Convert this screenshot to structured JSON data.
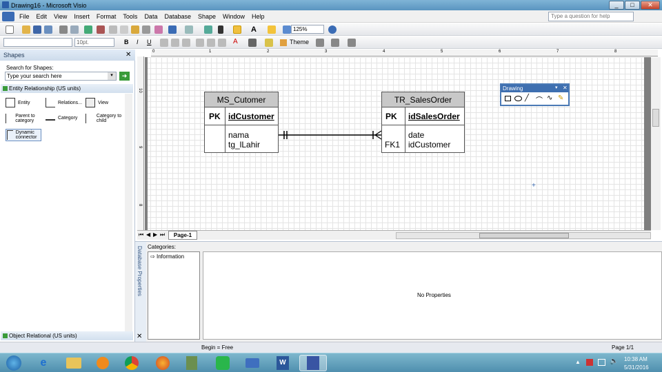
{
  "window": {
    "title": "Drawing16 - Microsoft Visio",
    "min": "_",
    "max": "□",
    "close": "✕"
  },
  "menu": [
    "File",
    "Edit",
    "View",
    "Insert",
    "Format",
    "Tools",
    "Data",
    "Database",
    "Shape",
    "Window",
    "Help"
  ],
  "help": {
    "placeholder": "Type a question for help"
  },
  "toolbar": {
    "zoom": "125%",
    "font_size": "10pt.",
    "theme": "Theme"
  },
  "shapes_panel": {
    "title": "Shapes",
    "search_label": "Search for Shapes:",
    "search_placeholder": "Type your search here",
    "stencil": "Entity Relationship (US units)",
    "items": [
      "Entity",
      "Relations...",
      "View",
      "Parent to category",
      "Category",
      "Category to child",
      "Dynamic connector"
    ],
    "stencil2": "Object Relational (US units)"
  },
  "ruler": {
    "top": [
      "0",
      "1",
      "2",
      "3",
      "4",
      "5",
      "6",
      "7",
      "8"
    ],
    "left": [
      "10",
      "9",
      "8"
    ]
  },
  "entities": [
    {
      "name": "MS_Cutomer",
      "pk_label": "PK",
      "pk": "idCustomer",
      "fields": [
        "nama",
        "tg_lLahir"
      ],
      "fk": []
    },
    {
      "name": "TR_SalesOrder",
      "pk_label": "PK",
      "pk": "idSalesOrder",
      "fields": [
        "date",
        "idCustomer"
      ],
      "fk": [
        "",
        "FK1"
      ]
    }
  ],
  "drawing_palette": {
    "title": "Drawing"
  },
  "page_tab": "Page-1",
  "db_props": {
    "side": "Database Properties",
    "categories_label": "Categories:",
    "category": "Information",
    "empty": "No Properties"
  },
  "status": {
    "begin": "Begin = Free",
    "page": "Page 1/1"
  },
  "clock": {
    "time": "10:38 AM",
    "date": "5/31/2016"
  }
}
